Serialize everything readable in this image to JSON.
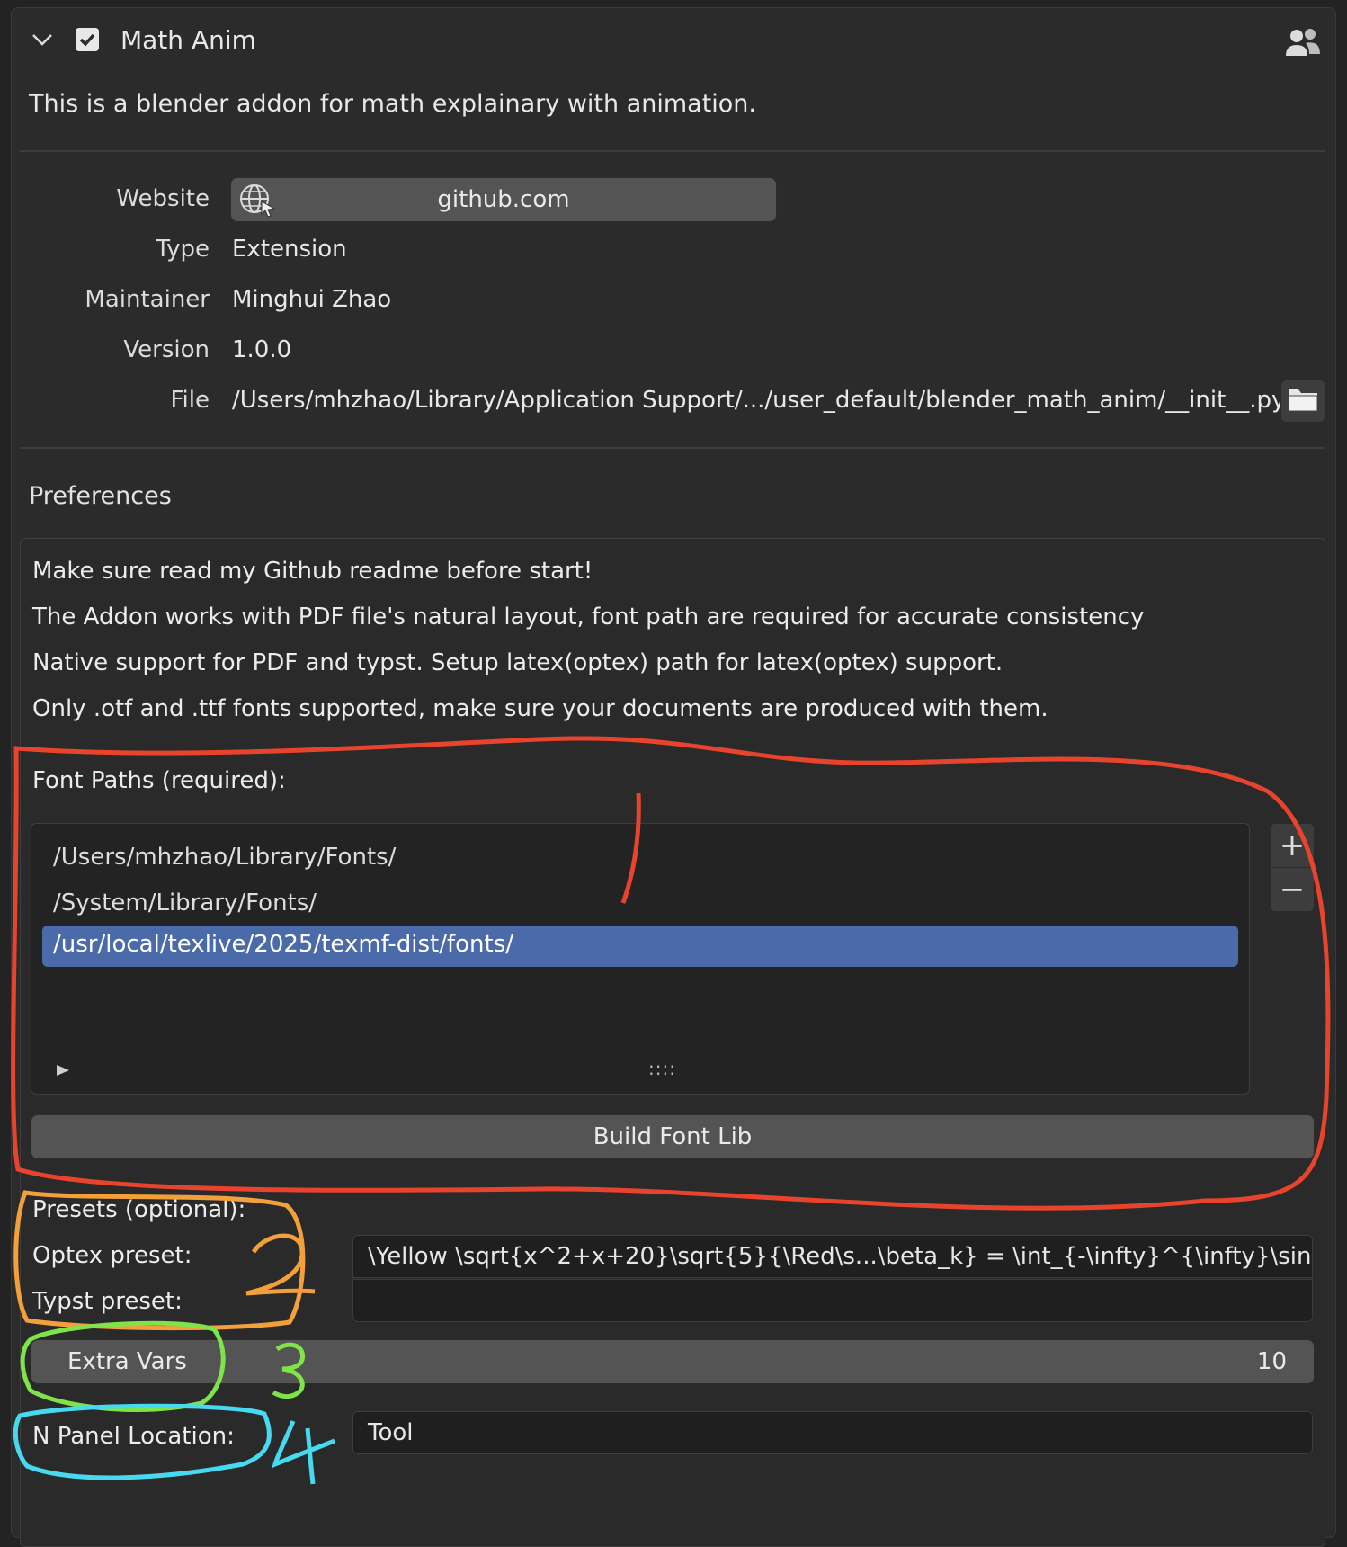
{
  "header": {
    "title": "Math Anim",
    "description": "This is a blender addon for math explainary with animation."
  },
  "info": {
    "website_label": "Website",
    "website_value": "github.com",
    "type_label": "Type",
    "type_value": "Extension",
    "maintainer_label": "Maintainer",
    "maintainer_value": "Minghui Zhao",
    "version_label": "Version",
    "version_value": "1.0.0",
    "file_label": "File",
    "file_value": "/Users/mhzhao/Library/Application Support/.../user_default/blender_math_anim/__init__.py"
  },
  "preferences": {
    "title": "Preferences",
    "notes": [
      "Make sure read my Github readme before start!",
      "The Addon works with PDF file's natural layout, font path are required for accurate consistency",
      "Native support for PDF and typst. Setup latex(optex) path for latex(optex) support.",
      "Only .otf and .ttf fonts supported, make sure your documents are produced with them."
    ],
    "font_paths_label": "Font Paths (required):",
    "font_paths": [
      "/Users/mhzhao/Library/Fonts/",
      "/System/Library/Fonts/",
      "/usr/local/texlive/2025/texmf-dist/fonts/"
    ],
    "list_grip": "::::",
    "add_symbol": "+",
    "remove_symbol": "−",
    "build_button": "Build Font Lib",
    "presets_label": "Presets (optional):",
    "optex_label": "Optex preset:",
    "optex_value": "\\Yellow \\sqrt{x^2+x+20}\\sqrt{5}{\\Red\\s...\\beta_k} = \\int_{-\\infty}^{\\infty}\\sin(x)dx",
    "typst_label": "Typst preset:",
    "typst_value": "",
    "extra_vars_label": "Extra Vars",
    "extra_vars_value": "10",
    "npanel_label": "N Panel Location:",
    "npanel_value": "Tool"
  },
  "annotations": {
    "colors": [
      "#e8432d",
      "#f4a03a",
      "#7fe34a",
      "#47d9f0"
    ]
  }
}
